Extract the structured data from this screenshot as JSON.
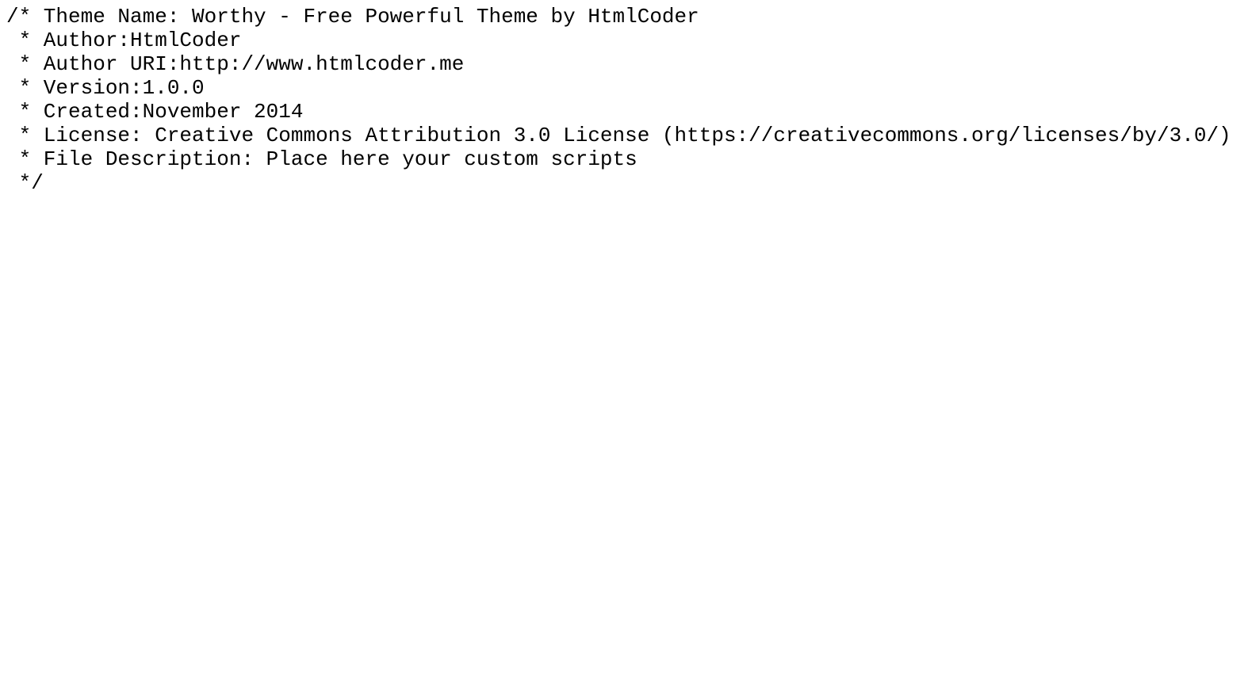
{
  "document": {
    "lines": [
      "/* Theme Name: Worthy - Free Powerful Theme by HtmlCoder",
      " * Author:HtmlCoder",
      " * Author URI:http://www.htmlcoder.me",
      " * Version:1.0.0",
      " * Created:November 2014",
      " * License: Creative Commons Attribution 3.0 License (https://creativecommons.org/licenses/by/3.0/)",
      " * File Description: Place here your custom scripts",
      " */"
    ]
  }
}
